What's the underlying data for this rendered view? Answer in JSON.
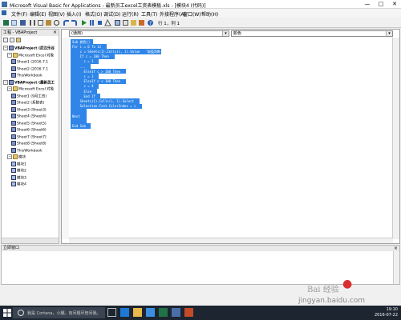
{
  "window": {
    "title": "Microsoft Visual Basic for Applications - 最新员工excel工资表模板.xls - [模块4 (代码)]",
    "controls": [
      "—",
      "□",
      "✕"
    ]
  },
  "menu": [
    "文件(F)",
    "编辑(E)",
    "视图(V)",
    "插入(I)",
    "格式(O)",
    "调试(D)",
    "运行(R)",
    "工具(T)",
    "外接程序(A)",
    "窗口(W)",
    "帮助(H)"
  ],
  "toolbar": {
    "position": "行 1，列 1",
    "icons": [
      "excel-icon",
      "insert-icon",
      "save-icon",
      "cut-icon",
      "copy-icon",
      "paste-icon",
      "find-icon",
      "undo-icon",
      "redo-icon",
      "run-icon",
      "break-icon",
      "reset-icon",
      "design-icon",
      "project-icon",
      "properties-icon",
      "object-browser-icon",
      "toolbox-icon",
      "help-icon"
    ]
  },
  "project_panel": {
    "title": "工程 - VBAProject",
    "tree": [
      {
        "label": "VBAProject (武汉乐谷",
        "level": 0,
        "kind": "project"
      },
      {
        "label": "Microsoft Excel 对象",
        "level": 1,
        "kind": "folder"
      },
      {
        "label": "Sheet1 (2016.7.1",
        "level": 2,
        "kind": "sheet"
      },
      {
        "label": "Sheet2 (2016.7.1",
        "level": 2,
        "kind": "sheet"
      },
      {
        "label": "ThisWorkbook",
        "level": 2,
        "kind": "sheet"
      },
      {
        "label": "VBAProject (最新员工",
        "level": 0,
        "kind": "project"
      },
      {
        "label": "Microsoft Excel 对象",
        "level": 1,
        "kind": "folder"
      },
      {
        "label": "Sheet1 (9月工资)",
        "level": 2,
        "kind": "sheet"
      },
      {
        "label": "Sheet2 (系数表)",
        "level": 2,
        "kind": "sheet"
      },
      {
        "label": "Sheet3 (Sheet3)",
        "level": 2,
        "kind": "sheet"
      },
      {
        "label": "Sheet4 (Sheet4)",
        "level": 2,
        "kind": "sheet"
      },
      {
        "label": "Sheet5 (Sheet5)",
        "level": 2,
        "kind": "sheet"
      },
      {
        "label": "Sheet6 (Sheet6)",
        "level": 2,
        "kind": "sheet"
      },
      {
        "label": "Sheet7 (Sheet7)",
        "level": 2,
        "kind": "sheet"
      },
      {
        "label": "Sheet8 (Sheet8)",
        "level": 2,
        "kind": "sheet"
      },
      {
        "label": "ThisWorkbook",
        "level": 2,
        "kind": "sheet"
      },
      {
        "label": "模块",
        "level": 1,
        "kind": "folder"
      },
      {
        "label": "模块1",
        "level": 2,
        "kind": "module"
      },
      {
        "label": "模块2",
        "level": 2,
        "kind": "module"
      },
      {
        "label": "模块3",
        "level": 2,
        "kind": "module"
      },
      {
        "label": "模块4",
        "level": 2,
        "kind": "module"
      }
    ]
  },
  "code_window": {
    "object_combo": "(通用)",
    "proc_combo": "颜色",
    "lines": [
      "Sub 颜色()",
      "For i = 6 To 12",
      "    c = Sheets(1).Cells(i, 1).Value   '取值判断",
      "    If c = 100 Then",
      "      c = 1",
      "    ...",
      "      ElseIf c > 100 Then",
      "      c = 3",
      "      ElseIf c < 100 Then",
      "      c = 4",
      "      Else",
      "      End If",
      "    Sheets(1).Cells(i, 1).Select",
      "    Selection.Font.ColorIndex = c",
      "",
      "Next",
      "",
      "End Sub"
    ]
  },
  "immediate": {
    "title": "立即窗口"
  },
  "watermark": {
    "text": "Bai 经验",
    "url": "jingyan.baidu.com"
  },
  "taskbar": {
    "search_placeholder": "我是 Cortana，小娜。有问题尽管问我。",
    "time": "19:10",
    "date": "2016-07-22"
  },
  "colors": {
    "selection": "#2f86e8",
    "taskbar": "#1c2530"
  }
}
